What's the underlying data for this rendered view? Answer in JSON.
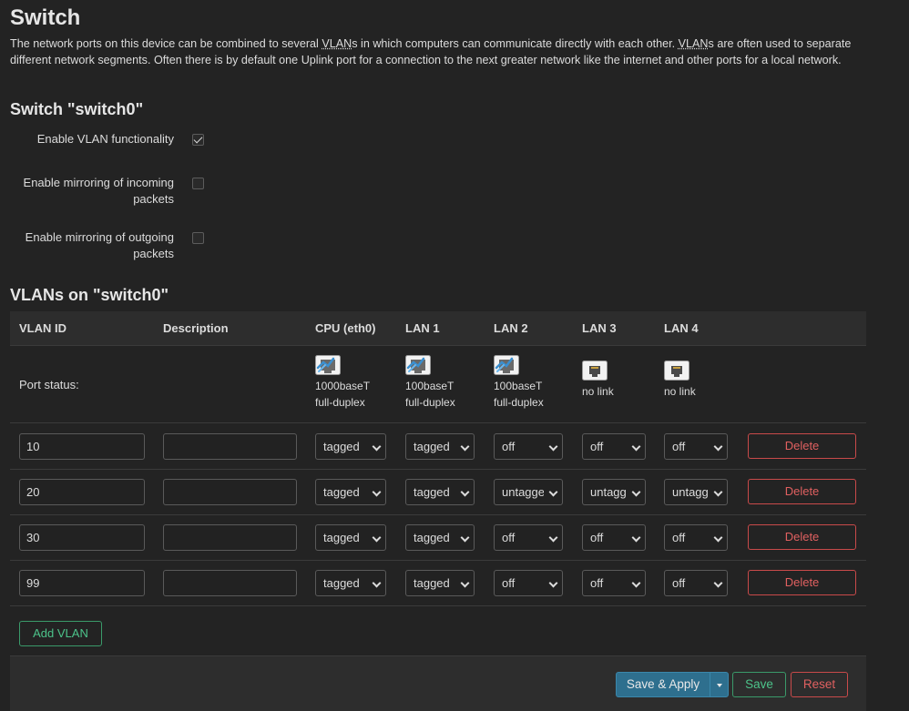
{
  "page": {
    "title": "Switch",
    "description": {
      "p1": "The network ports on this device can be combined to several ",
      "abbr1": "VLAN",
      "p2": "s in which computers can communicate directly with each other. ",
      "abbr2": "VLAN",
      "p3": "s are often used to separate different network segments. Often there is by default one Uplink port for a connection to the next greater network like the internet and other ports for a local network."
    }
  },
  "switch_section": {
    "title": "Switch \"switch0\"",
    "options": [
      {
        "label": "Enable VLAN functionality",
        "checked": true
      },
      {
        "label": "Enable mirroring of incoming packets",
        "checked": false
      },
      {
        "label": "Enable mirroring of outgoing packets",
        "checked": false
      }
    ]
  },
  "vlans_section": {
    "title": "VLANs on \"switch0\"",
    "columns": [
      "VLAN ID",
      "Description",
      "CPU (eth0)",
      "LAN 1",
      "LAN 2",
      "LAN 3",
      "LAN 4"
    ],
    "port_status_label": "Port status:",
    "ports": [
      {
        "speed": "1000baseT",
        "duplex": "full-duplex",
        "connected": true
      },
      {
        "speed": "100baseT",
        "duplex": "full-duplex",
        "connected": true
      },
      {
        "speed": "100baseT",
        "duplex": "full-duplex",
        "connected": true
      },
      {
        "speed": "no link",
        "duplex": "",
        "connected": false
      },
      {
        "speed": "no link",
        "duplex": "",
        "connected": false
      }
    ],
    "rows": [
      {
        "vlan_id": "10",
        "description": "",
        "ports": [
          "tagged",
          "tagged",
          "off",
          "off",
          "off"
        ],
        "delete_label": "Delete"
      },
      {
        "vlan_id": "20",
        "description": "",
        "ports": [
          "tagged",
          "tagged",
          "untagged",
          "untagged",
          "untagged"
        ],
        "delete_label": "Delete"
      },
      {
        "vlan_id": "30",
        "description": "",
        "ports": [
          "tagged",
          "tagged",
          "off",
          "off",
          "off"
        ],
        "delete_label": "Delete"
      },
      {
        "vlan_id": "99",
        "description": "",
        "ports": [
          "tagged",
          "tagged",
          "off",
          "off",
          "off"
        ],
        "delete_label": "Delete"
      }
    ],
    "add_label": "Add VLAN"
  },
  "footer": {
    "save_apply_label": "Save & Apply",
    "save_label": "Save",
    "reset_label": "Reset"
  },
  "icons": {
    "port_connected": "ethernet-port-connected-icon",
    "port_disconnected": "ethernet-port-disconnected-icon"
  },
  "colors": {
    "background": "#232323",
    "header_row": "#2d2d2d",
    "primary": "#2e6f8e",
    "positive": "#4cc38a",
    "negative": "#e06060"
  }
}
